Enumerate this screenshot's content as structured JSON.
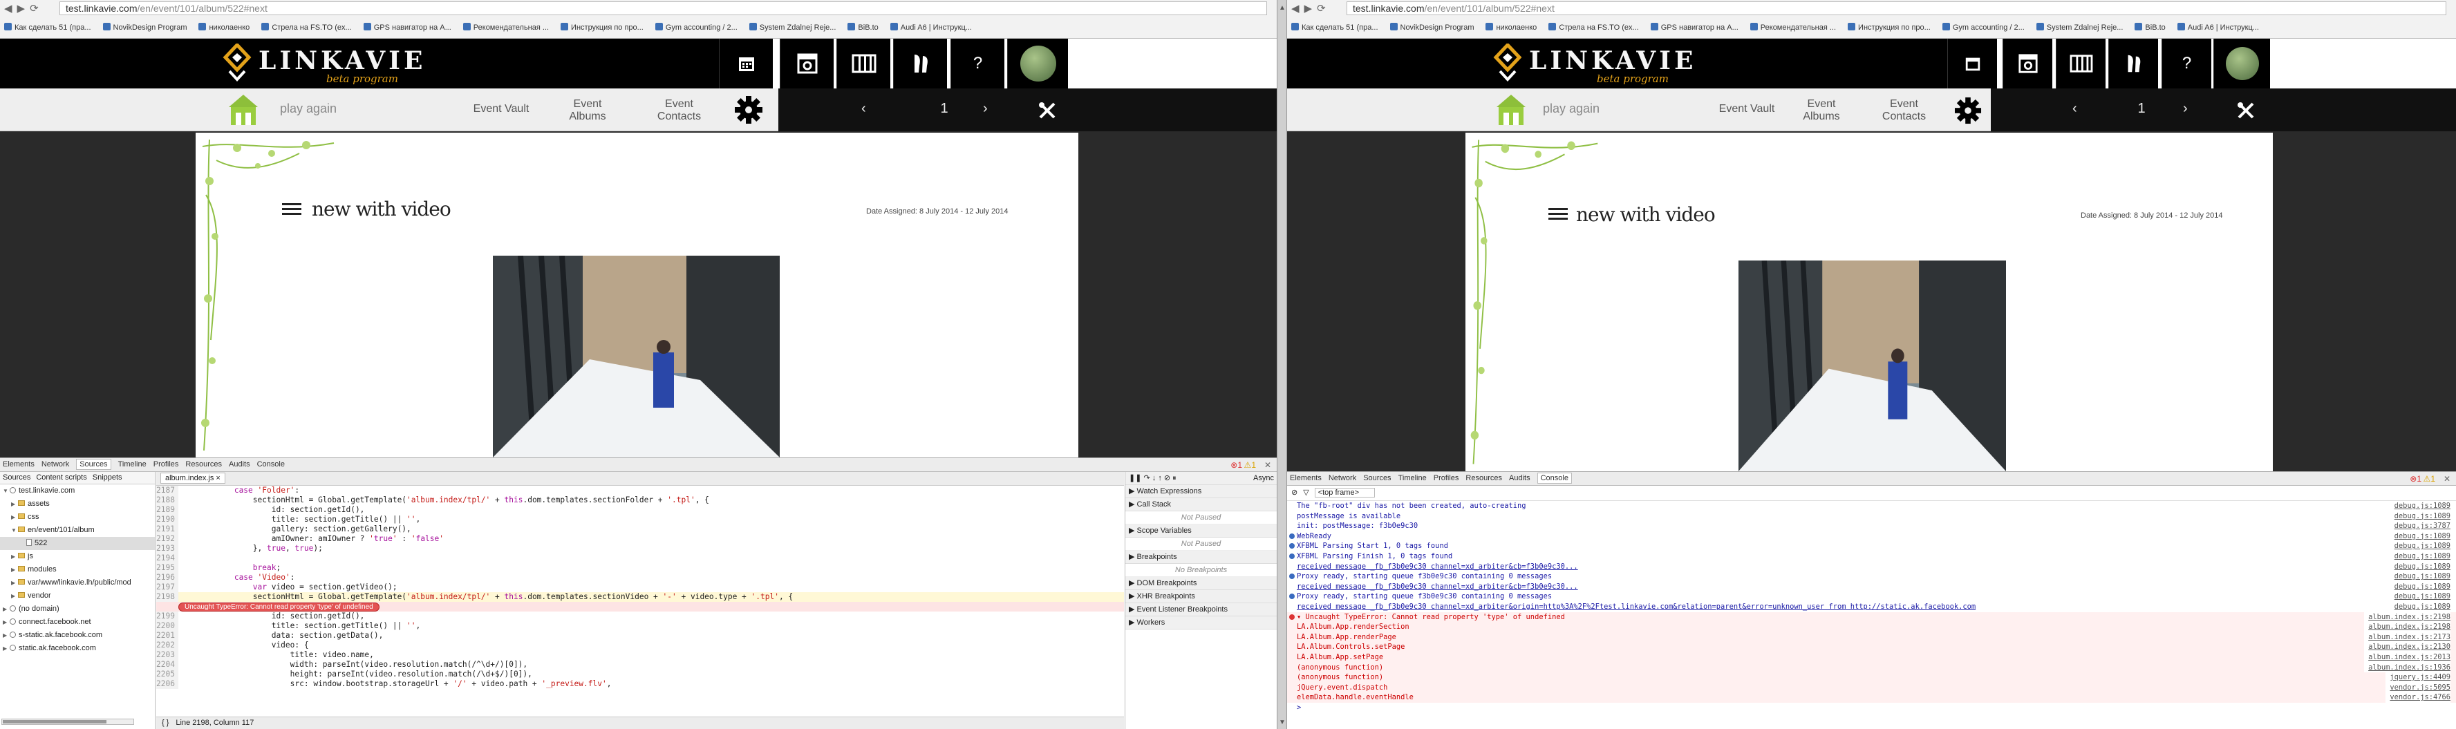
{
  "left": {
    "browser": {
      "url_host": "test.linkavie.com",
      "url_path": "/en/event/101/album/522#next"
    },
    "bookmarks": [
      "Как сделать 51 (пра...",
      "NovikDesign Program",
      "николаенко",
      "Стрела на FS.TO (ex...",
      "GPS навигатор на А...",
      "Рекомендательная ...",
      "Инструкция по про...",
      "Gym accounting / 2...",
      "System Zdalnej Reje...",
      "BiB.to",
      "Audi A6 | Инструкц..."
    ],
    "site": {
      "brand": "LINKAVIE",
      "beta": "beta program",
      "play_again": "play again",
      "links": [
        "Event Vault",
        "Event Albums",
        "Event Contacts"
      ],
      "page_number": "1",
      "prev": "‹",
      "next": "›",
      "help": "?",
      "album_title": "new with video",
      "dates": "Date Assigned: 8 July 2014 - 12 July 2014"
    },
    "devtools": {
      "tabs": [
        "Elements",
        "Network",
        "Sources",
        "Timeline",
        "Profiles",
        "Resources",
        "Audits",
        "Console"
      ],
      "error_count": "1",
      "warn_count": "1",
      "nav_tabs": [
        "Sources",
        "Content scripts",
        "Snippets"
      ],
      "tree": [
        {
          "label": "test.linkavie.com",
          "kind": "globe",
          "indent": 0,
          "open": true
        },
        {
          "label": "assets",
          "kind": "folder",
          "indent": 1,
          "open": false
        },
        {
          "label": "css",
          "kind": "folder",
          "indent": 1,
          "open": false
        },
        {
          "label": "en/event/101/album",
          "kind": "folder",
          "indent": 1,
          "open": true
        },
        {
          "label": "522",
          "kind": "page",
          "indent": 2,
          "open": null,
          "selected": true
        },
        {
          "label": "js",
          "kind": "folder",
          "indent": 1,
          "open": false
        },
        {
          "label": "modules",
          "kind": "folder",
          "indent": 1,
          "open": false
        },
        {
          "label": "var/www/linkavie.lh/public/mod",
          "kind": "folder",
          "indent": 1,
          "open": false
        },
        {
          "label": "vendor",
          "kind": "folder",
          "indent": 1,
          "open": false
        },
        {
          "label": "(no domain)",
          "kind": "globe",
          "indent": 0,
          "open": false
        },
        {
          "label": "connect.facebook.net",
          "kind": "globe",
          "indent": 0,
          "open": false
        },
        {
          "label": "s-static.ak.facebook.com",
          "kind": "globe",
          "indent": 0,
          "open": false
        },
        {
          "label": "static.ak.facebook.com",
          "kind": "globe",
          "indent": 0,
          "open": false
        }
      ],
      "file_tab": "album.index.js ×",
      "code": [
        {
          "n": "2187",
          "t": "            case 'Folder':"
        },
        {
          "n": "2188",
          "t": "                sectionHtml = Global.getTemplate('album.index/tpl/' + this.dom.templates.sectionFolder + '.tpl', {"
        },
        {
          "n": "2189",
          "t": "                    id: section.getId(),"
        },
        {
          "n": "2190",
          "t": "                    title: section.getTitle() || '',"
        },
        {
          "n": "2191",
          "t": "                    gallery: section.getGallery(),"
        },
        {
          "n": "2192",
          "t": "                    amIOwner: amIOwner ? 'true' : 'false'"
        },
        {
          "n": "2193",
          "t": "                }, true, true);"
        },
        {
          "n": "2194",
          "t": ""
        },
        {
          "n": "2195",
          "t": "                break;"
        },
        {
          "n": "2196",
          "t": "            case 'Video':"
        },
        {
          "n": "2197",
          "t": "                var video = section.getVideo();"
        },
        {
          "n": "2198",
          "t": "                sectionHtml = Global.getTemplate('album.index/tpl/' + this.dom.templates.sectionVideo + '-' + video.type + '.tpl', {"
        },
        {
          "n": "",
          "t": "",
          "error": "Uncaught TypeError: Cannot read property 'type' of undefined"
        },
        {
          "n": "2199",
          "t": "                    id: section.getId(),"
        },
        {
          "n": "2200",
          "t": "                    title: section.getTitle() || '',"
        },
        {
          "n": "2201",
          "t": "                    data: section.getData(),"
        },
        {
          "n": "2202",
          "t": "                    video: {"
        },
        {
          "n": "2203",
          "t": "                        title: video.name,"
        },
        {
          "n": "2204",
          "t": "                        width: parseInt(video.resolution.match(/^\\d+/)[0]),"
        },
        {
          "n": "2205",
          "t": "                        height: parseInt(video.resolution.match(/\\d+$/)[0]),"
        },
        {
          "n": "2206",
          "t": "                        src: window.bootstrap.storageUrl + '/' + video.path + '_preview.flv',"
        }
      ],
      "status": "Line 2198, Column 117",
      "side_async": "Async",
      "side": [
        {
          "h": "Watch Expressions",
          "np": ""
        },
        {
          "h": "Call Stack",
          "np": "Not Paused"
        },
        {
          "h": "Scope Variables",
          "np": "Not Paused"
        },
        {
          "h": "Breakpoints",
          "np": "No Breakpoints"
        },
        {
          "h": "DOM Breakpoints",
          "np": ""
        },
        {
          "h": "XHR Breakpoints",
          "np": ""
        },
        {
          "h": "Event Listener Breakpoints",
          "np": ""
        },
        {
          "h": "Workers",
          "np": ""
        }
      ]
    }
  },
  "right": {
    "browser": {
      "url_host": "test.linkavie.com",
      "url_path": "/en/event/101/album/522#next"
    },
    "bookmarks": [
      "Как сделать 51 (пра...",
      "NovikDesign Program",
      "николаенко",
      "Стрела на FS.TO (ex...",
      "GPS навигатор на А...",
      "Рекомендательная ...",
      "Инструкция по про...",
      "Gym accounting / 2...",
      "System Zdalnej Reje...",
      "BiB.to",
      "Audi A6 | Инструкц..."
    ],
    "devtools": {
      "tabs": [
        "Elements",
        "Network",
        "Sources",
        "Timeline",
        "Profiles",
        "Resources",
        "Audits",
        "Console"
      ],
      "filter": "<top frame>",
      "console": [
        {
          "cls": "info",
          "t": "The \"fb-root\" div has not been created, auto-creating",
          "s": "debug.js:1089"
        },
        {
          "cls": "info",
          "t": "  postMessage is available",
          "s": "debug.js:1089"
        },
        {
          "cls": "info",
          "t": "  init: postMessage: f3b0e9c30",
          "s": "debug.js:3787"
        },
        {
          "cls": "dot",
          "t": "   WebReady",
          "s": "debug.js:1089"
        },
        {
          "cls": "dot",
          "t": "   XFBML Parsing Start 1, 0 tags found",
          "s": "debug.js:1089"
        },
        {
          "cls": "dot",
          "t": "   XFBML Parsing Finish 1, 0 tags found",
          "s": "debug.js:1089"
        },
        {
          "cls": "lnk",
          "t": "   received message _fb_f3b0e9c30 channel=xd_arbiter&cb=f3b0e9c30...",
          "s": "debug.js:1089"
        },
        {
          "cls": "dot",
          "t": "   Proxy ready, starting queue f3b0e9c30 containing 0 messages",
          "s": "debug.js:1089"
        },
        {
          "cls": "lnk",
          "t": "   received message _fb_f3b0e9c30 channel=xd_arbiter&cb=f3b0e9c30...",
          "s": "debug.js:1089"
        },
        {
          "cls": "dot",
          "t": "   Proxy ready, starting queue f3b0e9c30 containing 0 messages",
          "s": "debug.js:1089"
        },
        {
          "cls": "lnk",
          "t": "   received message _fb_f3b0e9c30 channel=xd_arbiter&origin=http%3A%2F%2Ftest.linkavie.com&relation=parent&error=unknown_user from http://static.ak.facebook.com",
          "s": "debug.js:1089"
        },
        {
          "cls": "edot",
          "t": " ▾ Uncaught TypeError: Cannot read property 'type' of undefined",
          "s": "album.index.js:2198"
        },
        {
          "cls": "err",
          "t": "      LA.Album.App.renderSection",
          "s": "album.index.js:2198"
        },
        {
          "cls": "err",
          "t": "      LA.Album.App.renderPage",
          "s": "album.index.js:2173"
        },
        {
          "cls": "err",
          "t": "      LA.Album.Controls.setPage",
          "s": "album.index.js:2130"
        },
        {
          "cls": "err",
          "t": "      LA.Album.App.setPage",
          "s": "album.index.js:2013"
        },
        {
          "cls": "err",
          "t": "      (anonymous function)",
          "s": "album.index.js:1936"
        },
        {
          "cls": "err",
          "t": "      (anonymous function)",
          "s": "jquery.js:4409"
        },
        {
          "cls": "err",
          "t": "      jQuery.event.dispatch",
          "s": "vendor.js:5095"
        },
        {
          "cls": "err",
          "t": "      elemData.handle.eventHandle",
          "s": "vendor.js:4766"
        },
        {
          "cls": "info",
          "t": " >",
          "s": ""
        }
      ]
    }
  }
}
